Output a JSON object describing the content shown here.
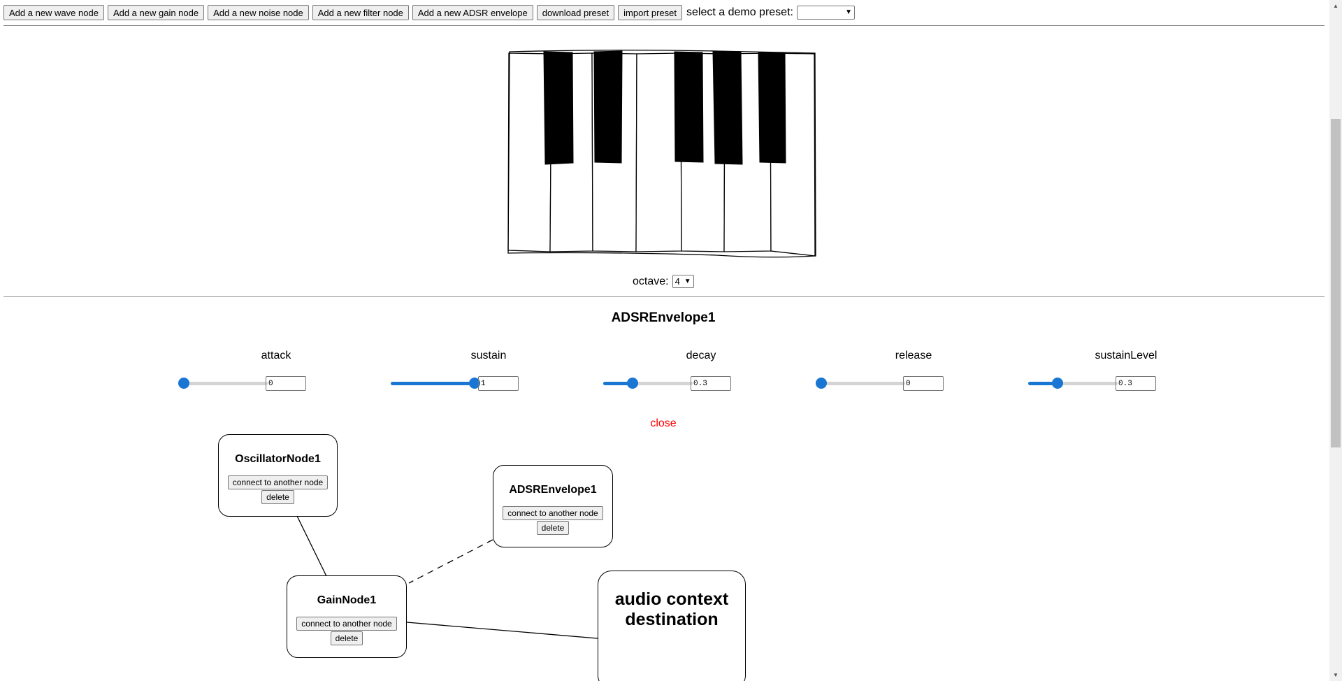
{
  "toolbar": {
    "buttons": {
      "add_wave": "Add a new wave node",
      "add_gain": "Add a new gain node",
      "add_noise": "Add a new noise node",
      "add_filter": "Add a new filter node",
      "add_adsr": "Add a new ADSR envelope",
      "download": "download preset",
      "import": "import preset"
    },
    "demo_label": "select a demo preset:",
    "demo_selected": ""
  },
  "keyboard": {
    "octave_label": "octave:",
    "octave_value": "4"
  },
  "envelope": {
    "title": "ADSREnvelope1",
    "params": [
      {
        "label": "attack",
        "value": "0",
        "fraction": 0
      },
      {
        "label": "sustain",
        "value": "1",
        "fraction": 1
      },
      {
        "label": "decay",
        "value": "0.3",
        "fraction": 0.3
      },
      {
        "label": "release",
        "value": "0",
        "fraction": 0
      },
      {
        "label": "sustainLevel",
        "value": "0.3",
        "fraction": 0.3
      }
    ],
    "close_label": "close"
  },
  "graph": {
    "nodes": [
      {
        "title": "OscillatorNode1",
        "connect_label": "connect to another node",
        "delete_label": "delete"
      },
      {
        "title": "ADSREnvelope1",
        "connect_label": "connect to another node",
        "delete_label": "delete"
      },
      {
        "title": "GainNode1",
        "connect_label": "connect to another node",
        "delete_label": "delete"
      }
    ],
    "destination_label": "audio context destination"
  },
  "colors": {
    "accent": "#1976d2",
    "close": "#ff0000"
  }
}
